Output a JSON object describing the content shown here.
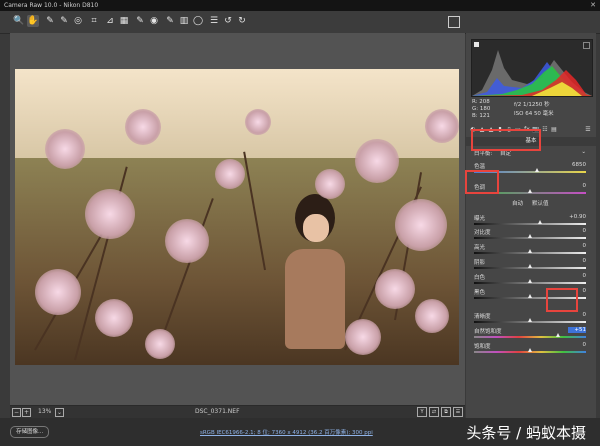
{
  "window": {
    "title": "Camera Raw 10.0 - Nikon D810",
    "close_icon": "close-icon"
  },
  "toolbar": {
    "tools": [
      {
        "icon": "zoom-icon",
        "glyph": "🔍"
      },
      {
        "icon": "hand-icon",
        "glyph": "✋"
      },
      {
        "icon": "white-balance-icon",
        "glyph": "✎"
      },
      {
        "icon": "color-sampler-icon",
        "glyph": "✎"
      },
      {
        "icon": "targeted-adjust-icon",
        "glyph": "◎"
      },
      {
        "icon": "crop-icon",
        "glyph": "⌗"
      },
      {
        "icon": "straighten-icon",
        "glyph": "⊿"
      },
      {
        "icon": "transform-icon",
        "glyph": "▦"
      },
      {
        "icon": "spot-removal-icon",
        "glyph": "✎"
      },
      {
        "icon": "red-eye-icon",
        "glyph": "◉"
      },
      {
        "icon": "adjustment-brush-icon",
        "glyph": "✎"
      },
      {
        "icon": "graduated-filter-icon",
        "glyph": "▥"
      },
      {
        "icon": "radial-filter-icon",
        "glyph": "◯"
      },
      {
        "icon": "preferences-icon",
        "glyph": "☰"
      },
      {
        "icon": "rotate-left-icon",
        "glyph": "↺"
      },
      {
        "icon": "rotate-right-icon",
        "glyph": "↻"
      }
    ],
    "fullscreen_icon": "fullscreen-icon"
  },
  "readout": {
    "r": "R:  208",
    "g": "G:  180",
    "b": "B:  121",
    "aperture_shutter": "f/2  1/1250 秒",
    "iso_focal": "ISO 64  50 毫米"
  },
  "panel": {
    "title": "基本",
    "white_balance_label": "白平衡:",
    "white_balance_value": "自定",
    "auto_label": "自动",
    "default_label": "默认值",
    "sliders": [
      {
        "key": "temperature",
        "label": "色温",
        "value": "6850",
        "level": 0.56
      },
      {
        "key": "tint",
        "label": "色调",
        "value": "0",
        "level": 0.5
      },
      {
        "key": "exposure",
        "label": "曝光",
        "value": "+0.90",
        "level": 0.59
      },
      {
        "key": "contrast",
        "label": "对比度",
        "value": "0",
        "level": 0.5
      },
      {
        "key": "highlights",
        "label": "高光",
        "value": "0",
        "level": 0.5
      },
      {
        "key": "shadows",
        "label": "阴影",
        "value": "0",
        "level": 0.5
      },
      {
        "key": "whites",
        "label": "白色",
        "value": "0",
        "level": 0.5
      },
      {
        "key": "blacks",
        "label": "黑色",
        "value": "0",
        "level": 0.5
      },
      {
        "key": "clarity",
        "label": "清晰度",
        "value": "0",
        "level": 0.5
      },
      {
        "key": "vibrance",
        "label": "自然饱和度",
        "value": "+51",
        "level": 0.75
      },
      {
        "key": "saturation",
        "label": "饱和度",
        "value": "0",
        "level": 0.5
      }
    ]
  },
  "bottom": {
    "zoom_value": "13%",
    "filename": "DSC_0371.NEF",
    "save_button": "存储图像...",
    "workflow_link": "sRGB IEC61966-2.1; 8 位; 7360 x 4912 (36.2 百万像素); 300 ppi"
  },
  "watermark": "头条号 / 蚂蚁本摄",
  "colors": {
    "highlight_box": "#e8443d",
    "selection": "#3e73d8"
  }
}
